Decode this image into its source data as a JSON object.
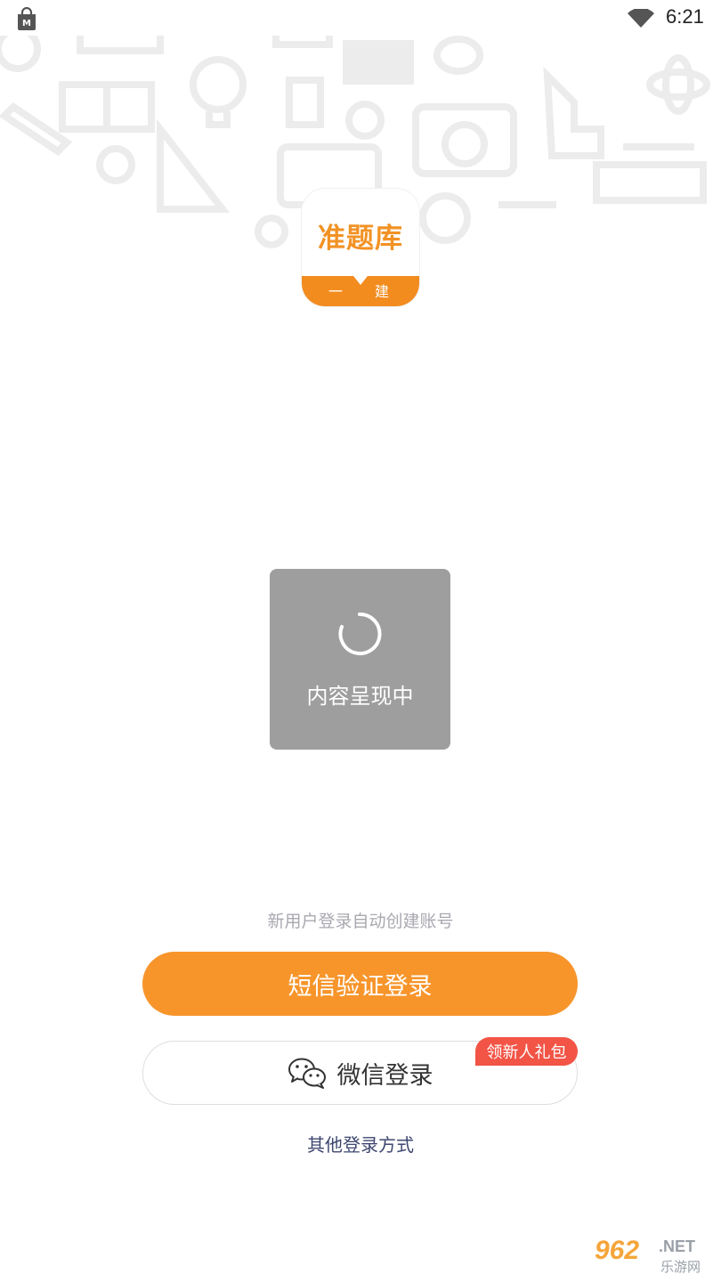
{
  "status_bar": {
    "time": "6:21"
  },
  "logo": {
    "title": "准题库",
    "sub_left": "一",
    "sub_right": "建"
  },
  "loading": {
    "text": "内容呈现中"
  },
  "login": {
    "hint": "新用户登录自动创建账号",
    "sms_button": "短信验证登录",
    "wechat_button": "微信登录",
    "wechat_badge": "领新人礼包",
    "other_methods": "其他登录方式"
  },
  "watermark": {
    "number": "962",
    "suffix": ".NET",
    "site": "乐游网"
  },
  "colors": {
    "accent": "#f7952b",
    "badge": "#f25446",
    "loading_bg": "#9e9e9e",
    "link": "#3e4770"
  }
}
